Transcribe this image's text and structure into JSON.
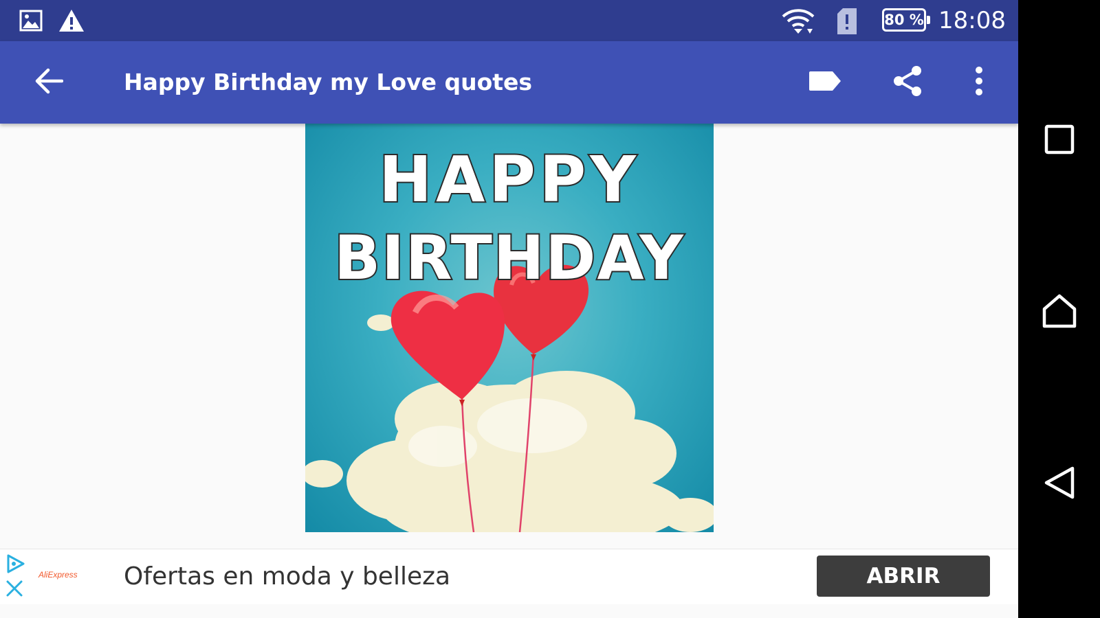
{
  "status_bar": {
    "time": "18:08",
    "battery": "80 %",
    "icons": [
      "image-icon",
      "warning-icon",
      "wifi-icon",
      "sim-alert-icon",
      "battery-icon"
    ]
  },
  "app_bar": {
    "title": "Happy Birthday my Love quotes",
    "icons": [
      "back-arrow-icon",
      "label-icon",
      "share-icon",
      "more-vert-icon"
    ]
  },
  "card": {
    "line1": "HAPPY",
    "line2": "BIRTHDAY"
  },
  "ad": {
    "brand": "AliExpress",
    "text": "Ofertas en moda y belleza",
    "button": "ABRIR",
    "icons": [
      "adchoices-icon",
      "close-icon"
    ]
  },
  "nav_bar": {
    "icons": [
      "recents-icon",
      "home-icon",
      "back-icon"
    ]
  },
  "colors": {
    "status_bar": "#2f3d8f",
    "app_bar": "#3f51b5",
    "nav_bar": "#000000",
    "ad_button": "#3d3d3d"
  }
}
